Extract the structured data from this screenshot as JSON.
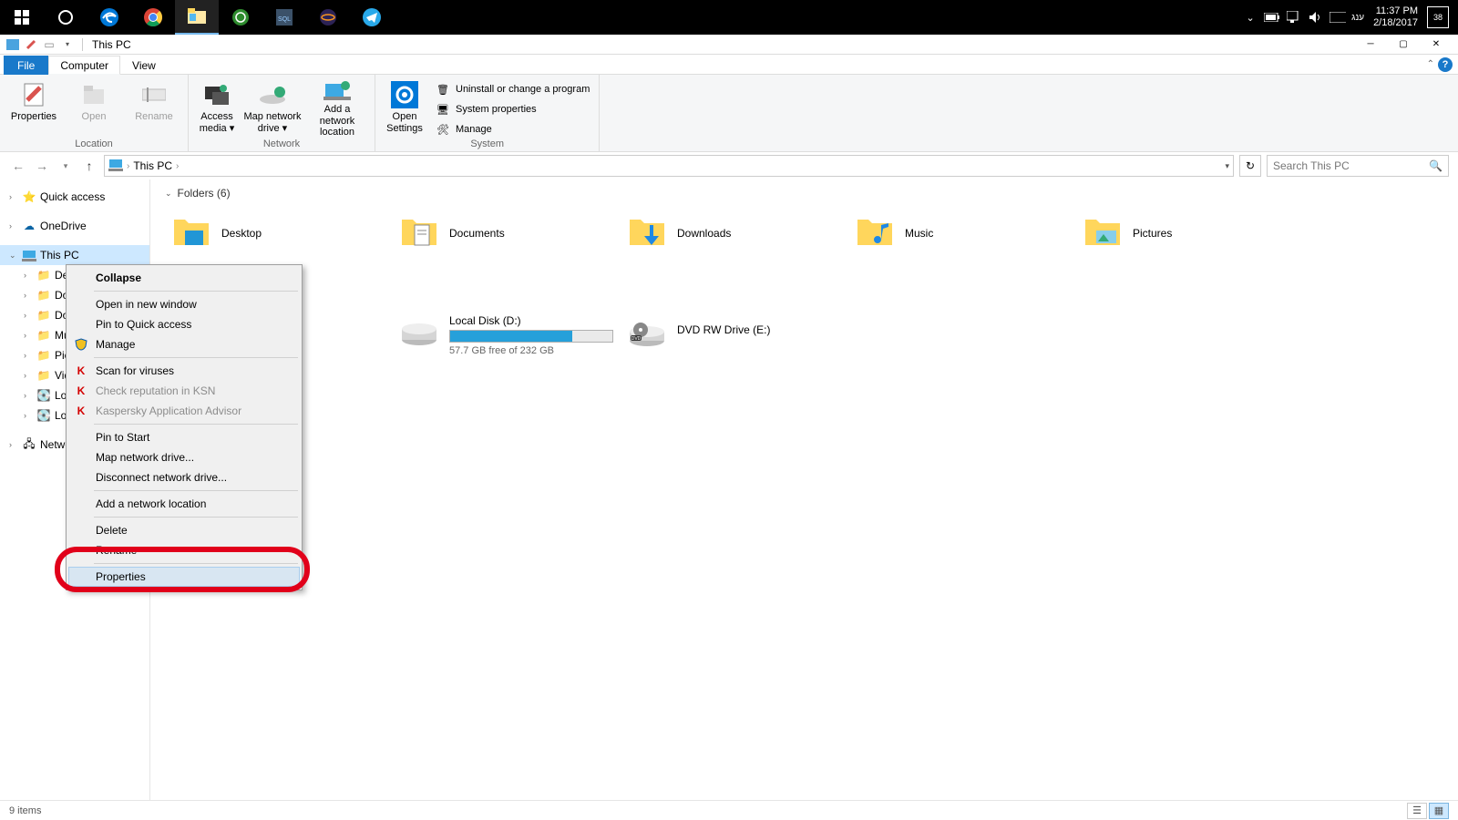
{
  "taskbar": {
    "clock_time": "11:37 PM",
    "clock_date": "2/18/2017",
    "lang": "ענג",
    "action_center_count": "38"
  },
  "titlebar": {
    "title": "This PC"
  },
  "ribbon": {
    "tabs": {
      "file": "File",
      "computer": "Computer",
      "view": "View"
    },
    "location": {
      "properties": "Properties",
      "open": "Open",
      "rename": "Rename",
      "group": "Location"
    },
    "network": {
      "access_media": "Access media ▾",
      "map_drive": "Map network drive ▾",
      "add_location": "Add a network location",
      "group": "Network"
    },
    "system": {
      "open_settings": "Open Settings",
      "uninstall": "Uninstall or change a program",
      "sys_props": "System properties",
      "manage": "Manage",
      "group": "System"
    }
  },
  "address": {
    "this_pc": "This PC"
  },
  "search": {
    "placeholder": "Search This PC"
  },
  "tree": {
    "quick": "Quick access",
    "onedrive": "OneDrive",
    "thispc": "This PC",
    "desktop": "Desktop",
    "documents": "Documents",
    "downloads": "Downloads",
    "music": "Music",
    "pictures": "Pictures",
    "videos": "Videos",
    "local_c": "Local Disk (C:)",
    "local_d": "Local Disk (D:)",
    "network": "Network"
  },
  "content": {
    "folders_header": "Folders (6)",
    "folders": {
      "desktop": "Desktop",
      "documents": "Documents",
      "downloads": "Downloads",
      "music": "Music",
      "pictures": "Pictures"
    },
    "d_drive": {
      "name": "Local Disk (D:)",
      "free": "57.7 GB free of 232 GB",
      "fill_pct": 75
    },
    "dvd": {
      "name": "DVD RW Drive (E:)"
    }
  },
  "ctx": {
    "collapse": "Collapse",
    "open_new": "Open in new window",
    "pin_quick": "Pin to Quick access",
    "manage": "Manage",
    "scan": "Scan for viruses",
    "ksn": "Check reputation in KSN",
    "kav": "Kaspersky Application Advisor",
    "pin_start": "Pin to Start",
    "map_drive": "Map network drive...",
    "disconnect": "Disconnect network drive...",
    "add_loc": "Add a network location",
    "delete": "Delete",
    "rename": "Rename",
    "properties": "Properties"
  },
  "status": {
    "items": "9 items"
  }
}
